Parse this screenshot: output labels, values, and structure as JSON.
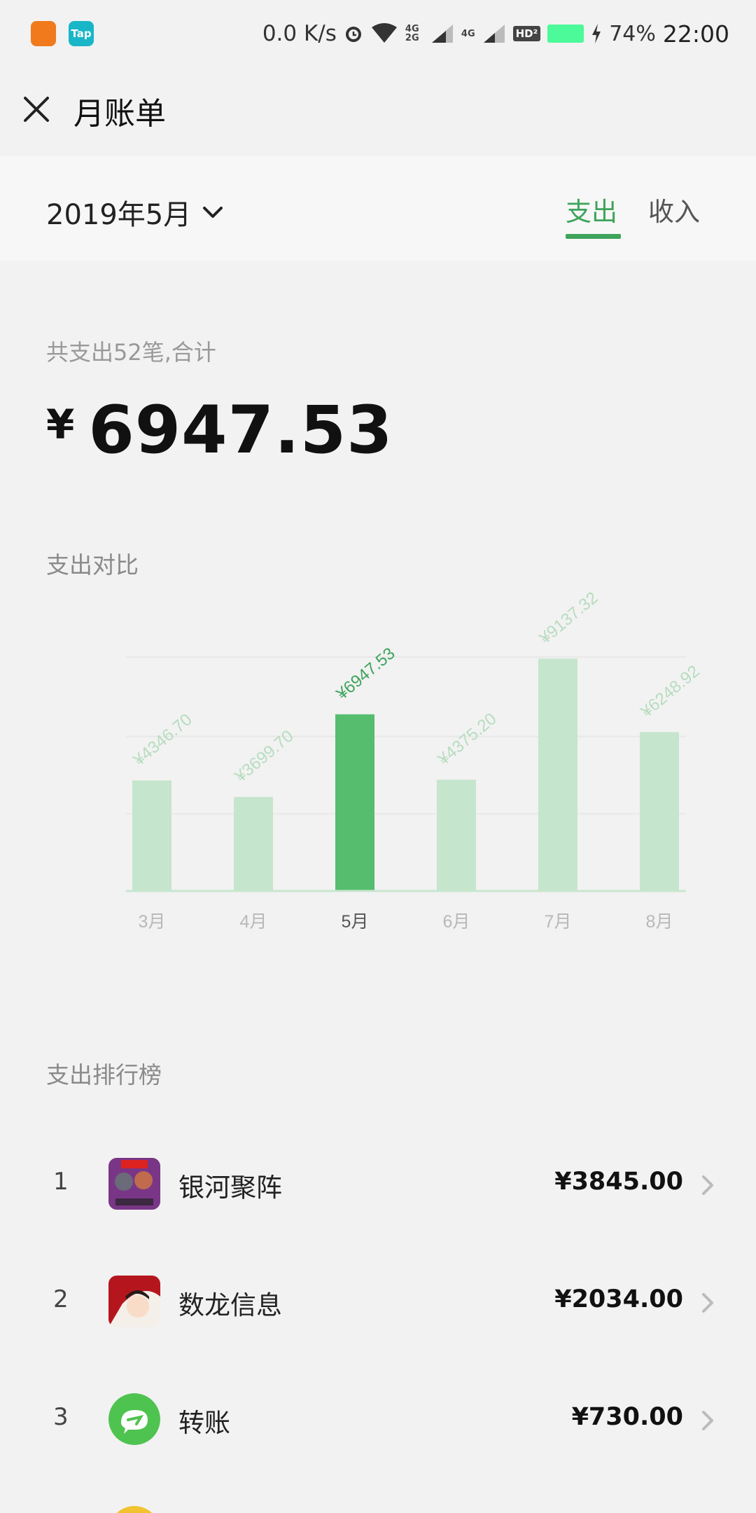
{
  "status_bar": {
    "app_icons": [
      {
        "icon": "fox-app-icon"
      },
      {
        "icon": "taptap-app-icon",
        "label": "Tap"
      }
    ],
    "net_speed": "0.0 K/s",
    "net_type_a": "4G 2G",
    "net_type_b": "4G",
    "hd_badge": "HD²",
    "battery_percent": "74%",
    "time": "22:00"
  },
  "header": {
    "close_icon": "close-icon",
    "title": "月账单"
  },
  "month_bar": {
    "month": "2019年5月",
    "tabs": [
      {
        "label": "支出",
        "active": true
      },
      {
        "label": "收入",
        "active": false
      }
    ],
    "accent": "#3ea45b"
  },
  "summary": {
    "caption": "共支出52笔,合计",
    "currency": "¥",
    "total": "6947.53"
  },
  "compare": {
    "title": "支出对比"
  },
  "chart_data": {
    "type": "bar",
    "categories": [
      "3月",
      "4月",
      "5月",
      "6月",
      "7月",
      "8月"
    ],
    "values": [
      4346.7,
      3699.7,
      6947.53,
      4375.2,
      9137.32,
      6248.92
    ],
    "value_labels": [
      "¥4346.70",
      "¥3699.70",
      "¥6947.53",
      "¥4375.20",
      "¥9137.32",
      "¥6248.92"
    ],
    "highlight_index": 2,
    "ylim": [
      0,
      9200
    ],
    "grid": true,
    "colors": {
      "bar": "#c5e5cc",
      "bar_active": "#56bd6f",
      "label": "#b7dcbf",
      "label_active": "#3ea45b",
      "axis": "#c8e6cf"
    }
  },
  "ranking": {
    "title": "支出排行榜",
    "items": [
      {
        "rank": "1",
        "name": "银河聚阵",
        "amount": "¥3845.00",
        "icon": "marvel-game-icon"
      },
      {
        "rank": "2",
        "name": "数龙信息",
        "amount": "¥2034.00",
        "icon": "anime-game-icon"
      },
      {
        "rank": "3",
        "name": "转账",
        "amount": "¥730.00",
        "icon": "wechat-transfer-icon"
      }
    ]
  }
}
